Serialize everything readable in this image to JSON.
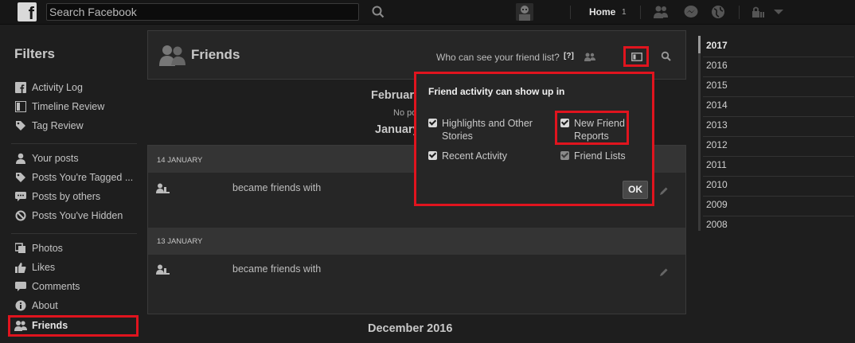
{
  "topbar": {
    "logo": "f",
    "search_placeholder": "Search Facebook",
    "home_label": "Home",
    "home_count": "1"
  },
  "filters": {
    "title": "Filters",
    "group1": [
      {
        "label": "Activity Log",
        "icon": "facebook-square-icon"
      },
      {
        "label": "Timeline Review",
        "icon": "timeline-icon"
      },
      {
        "label": "Tag Review",
        "icon": "tag-icon"
      }
    ],
    "group2": [
      {
        "label": "Your posts",
        "icon": "person-icon"
      },
      {
        "label": "Posts You're Tagged ...",
        "icon": "tag-icon"
      },
      {
        "label": "Posts by others",
        "icon": "speech-icon"
      },
      {
        "label": "Posts You've Hidden",
        "icon": "hidden-icon"
      }
    ],
    "group3": [
      {
        "label": "Photos",
        "icon": "photos-icon"
      },
      {
        "label": "Likes",
        "icon": "like-icon"
      },
      {
        "label": "Comments",
        "icon": "comment-icon"
      },
      {
        "label": "About",
        "icon": "info-icon"
      },
      {
        "label": "Friends",
        "icon": "friends-icon"
      }
    ]
  },
  "main": {
    "section_title": "Friends",
    "who_can_see": "Who can see your friend list?",
    "who_help": "[?]",
    "month_partial_top": "Februar",
    "no_posts_partial": "No po",
    "month_partial_jan": "January",
    "entries": [
      {
        "date": "14 JANUARY",
        "text": "became friends with"
      },
      {
        "date": "13 JANUARY",
        "text": "became friends with"
      }
    ],
    "month_bottom": "December 2016"
  },
  "popover": {
    "title": "Friend activity can show up in",
    "options": [
      {
        "label_line1": "Highlights and Other",
        "label_line2": "Stories",
        "checked": true
      },
      {
        "label_line1": "New Friend",
        "label_line2": "Reports",
        "checked": true
      },
      {
        "label_line1": "Recent Activity",
        "label_line2": "",
        "checked": true
      },
      {
        "label_line1": "Friend Lists",
        "label_line2": "",
        "checked": true
      }
    ],
    "ok_label": "OK"
  },
  "years": [
    "2017",
    "2016",
    "2015",
    "2014",
    "2013",
    "2012",
    "2011",
    "2010",
    "2009",
    "2008"
  ],
  "colors": {
    "highlight": "#e0141e",
    "background": "#1e1e1e"
  }
}
